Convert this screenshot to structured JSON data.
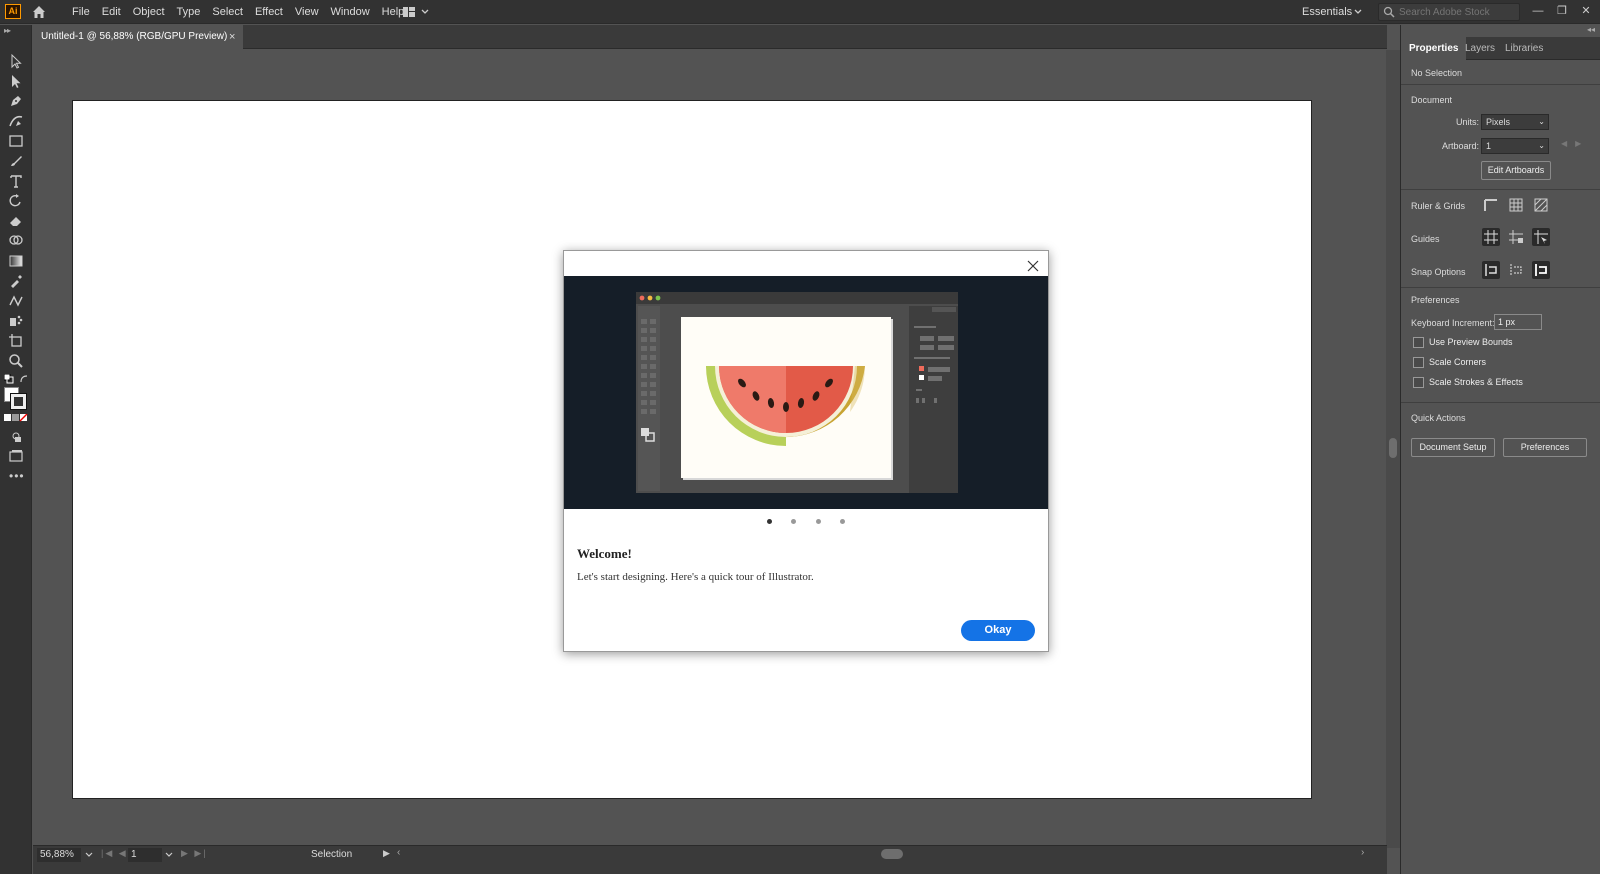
{
  "app": {
    "logo_text": "Ai",
    "menus": [
      "File",
      "Edit",
      "Object",
      "Type",
      "Select",
      "Effect",
      "View",
      "Window",
      "Help"
    ],
    "workspace": "Essentials",
    "stock_search_placeholder": "Search Adobe Stock"
  },
  "document_tab": {
    "title": "Untitled-1 @ 56,88% (RGB/GPU Preview)",
    "close": "×"
  },
  "status_bar": {
    "zoom": "56,88%",
    "artboard_number": "1",
    "tool": "Selection"
  },
  "properties_panel": {
    "tabs": [
      "Properties",
      "Layers",
      "Libraries"
    ],
    "active_tab": "Properties",
    "selection_status": "No Selection",
    "document_section": "Document",
    "units_label": "Units:",
    "units_value": "Pixels",
    "artboard_label": "Artboard:",
    "artboard_value": "1",
    "edit_artboards": "Edit Artboards",
    "ruler_grids": "Ruler & Grids",
    "guides": "Guides",
    "snap_options": "Snap Options",
    "preferences_section": "Preferences",
    "keyboard_increment_label": "Keyboard Increment:",
    "keyboard_increment_value": "1 px",
    "use_preview_bounds": "Use Preview Bounds",
    "scale_corners": "Scale Corners",
    "scale_strokes_effects": "Scale Strokes & Effects",
    "quick_actions": "Quick Actions",
    "document_setup_button": "Document Setup",
    "preferences_button": "Preferences"
  },
  "welcome_dialog": {
    "title": "Welcome!",
    "body": "Let's start designing. Here's a quick tour of Illustrator.",
    "okay_button": "Okay",
    "page_count": 4,
    "current_page": 1
  },
  "colors": {
    "accent": "#1473e6",
    "hero_background": "#151e28",
    "watermelon_flesh": "#ef6b5b",
    "watermelon_rind": "#b8d05a"
  }
}
